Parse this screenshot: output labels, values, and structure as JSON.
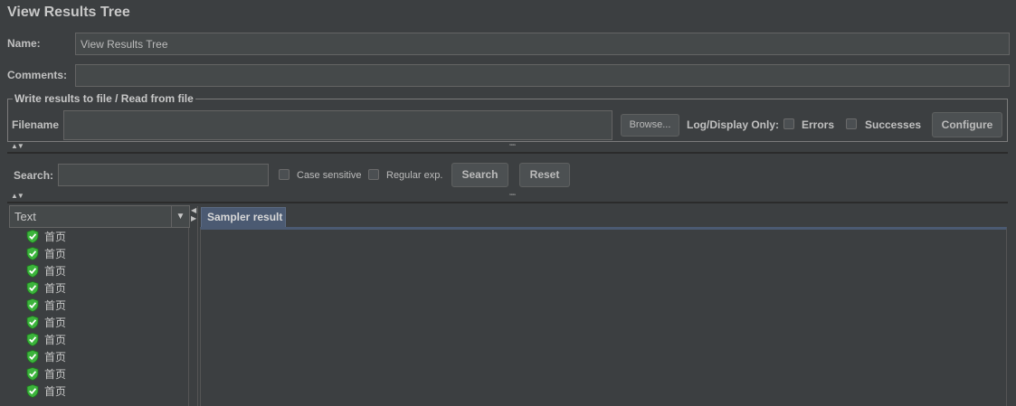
{
  "title": "View Results Tree",
  "name": {
    "label": "Name:",
    "value": "View Results Tree"
  },
  "comments": {
    "label": "Comments:",
    "value": ""
  },
  "file_group": {
    "legend": "Write results to file / Read from file",
    "filename_label": "Filename",
    "filename_value": "",
    "browse_label": "Browse...",
    "log_display_label": "Log/Display Only:",
    "errors_label": "Errors",
    "successes_label": "Successes",
    "configure_label": "Configure"
  },
  "search": {
    "label": "Search:",
    "value": "",
    "case_sensitive_label": "Case sensitive",
    "regex_label": "Regular exp.",
    "search_button": "Search",
    "reset_button": "Reset"
  },
  "renderer": {
    "selected": "Text"
  },
  "tree": {
    "items": [
      {
        "label": "首页",
        "status": "success"
      },
      {
        "label": "首页",
        "status": "success"
      },
      {
        "label": "首页",
        "status": "success"
      },
      {
        "label": "首页",
        "status": "success"
      },
      {
        "label": "首页",
        "status": "success"
      },
      {
        "label": "首页",
        "status": "success"
      },
      {
        "label": "首页",
        "status": "success"
      },
      {
        "label": "首页",
        "status": "success"
      },
      {
        "label": "首页",
        "status": "success"
      },
      {
        "label": "首页",
        "status": "success"
      }
    ]
  },
  "tabs": [
    {
      "label": "Sampler result"
    }
  ],
  "colors": {
    "success": "#3cb43c",
    "tab": "#4b5a72",
    "background": "#3c3f41"
  },
  "icons": {
    "tree_item": "success-shield-icon",
    "collapse": "collapse-arrows-icon",
    "dropdown": "dropdown-arrow-icon"
  }
}
